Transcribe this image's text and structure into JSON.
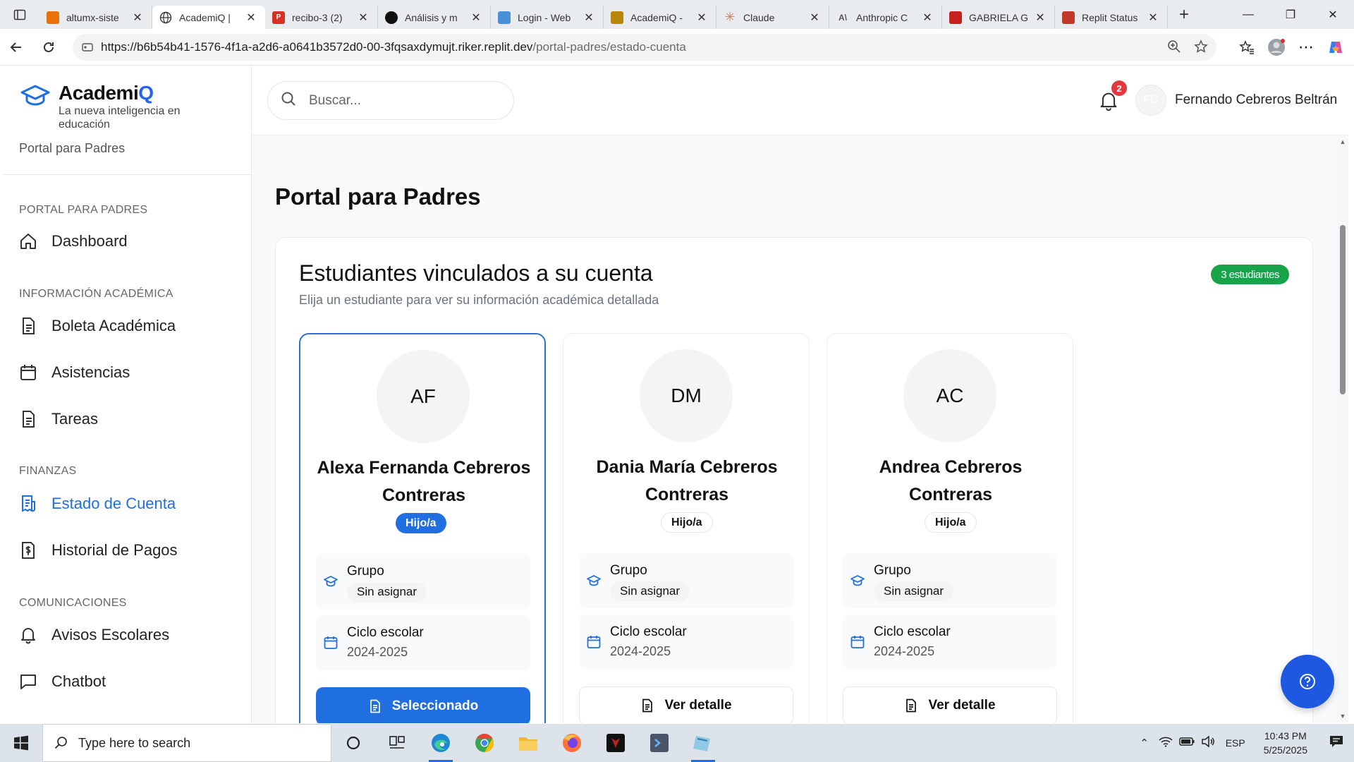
{
  "browser": {
    "tabs": [
      {
        "title": "altumx-siste",
        "favicon_color": "#e8710a"
      },
      {
        "title": "AcademiQ |",
        "favicon_color": "#444444",
        "active": true
      },
      {
        "title": "recibo-3 (2)",
        "favicon_color": "#d93025"
      },
      {
        "title": "Análisis y m",
        "favicon_color": "#111111"
      },
      {
        "title": "Login - Web",
        "favicon_color": "#4a90d9"
      },
      {
        "title": "AcademiQ -",
        "favicon_color": "#b8860b"
      },
      {
        "title": "Claude",
        "favicon_color": "#d97757"
      },
      {
        "title": "Anthropic C",
        "favicon_color": "#888888"
      },
      {
        "title": "GABRIELA G",
        "favicon_color": "#c5221f"
      },
      {
        "title": "Replit Status",
        "favicon_color": "#c0392b"
      }
    ],
    "url_host": "https://b6b54b41-1576-4f1a-a2d6-a0641b3572d0-00-3fqsaxdymujt.riker.replit.dev",
    "url_path": "/portal-padres/estado-cuenta"
  },
  "sidebar": {
    "app_name_prefix": "Academi",
    "app_name_suffix": "Q",
    "tagline": "La nueva inteligencia en educación",
    "portal_label": "Portal para Padres",
    "sections": {
      "portal": "PORTAL PARA PADRES",
      "academic": "INFORMACIÓN ACADÉMICA",
      "finance": "FINANZAS",
      "comms": "COMUNICACIONES"
    },
    "items": {
      "dashboard": "Dashboard",
      "boleta": "Boleta Académica",
      "asistencias": "Asistencias",
      "tareas": "Tareas",
      "estado_cuenta": "Estado de Cuenta",
      "historial_pagos": "Historial de Pagos",
      "avisos": "Avisos Escolares",
      "chatbot": "Chatbot"
    },
    "active_item": "Estado de Cuenta"
  },
  "header": {
    "search_placeholder": "Buscar...",
    "notification_count": "2",
    "user_initials": "FC",
    "user_name": "Fernando Cebreros Beltrán"
  },
  "main": {
    "page_title": "Portal para Padres",
    "panel_title": "Estudiantes vinculados a su cuenta",
    "panel_subtitle": "Elija un estudiante para ver su información académica detallada",
    "student_count": "3 estudiantes",
    "group_label": "Grupo",
    "cycle_label": "Ciclo escolar",
    "students": [
      {
        "initials": "AF",
        "name": "Alexa Fernanda Cebreros Contreras",
        "relation": "Hijo/a",
        "group": "Sin asignar",
        "cycle": "2024-2025",
        "button": "Seleccionado",
        "selected": true
      },
      {
        "initials": "DM",
        "name": "Dania María Cebreros Contreras",
        "relation": "Hijo/a",
        "group": "Sin asignar",
        "cycle": "2024-2025",
        "button": "Ver detalle",
        "selected": false
      },
      {
        "initials": "AC",
        "name": "Andrea Cebreros Contreras",
        "relation": "Hijo/a",
        "group": "Sin asignar",
        "cycle": "2024-2025",
        "button": "Ver detalle",
        "selected": false
      }
    ]
  },
  "taskbar": {
    "search_placeholder": "Type here to search",
    "language": "ESP",
    "time": "10:43 PM",
    "date": "5/25/2025"
  },
  "colors": {
    "primary": "#1f6fe0",
    "success_badge": "#16a34a",
    "notification": "#e0393e",
    "help_fab": "#1f58e0"
  }
}
